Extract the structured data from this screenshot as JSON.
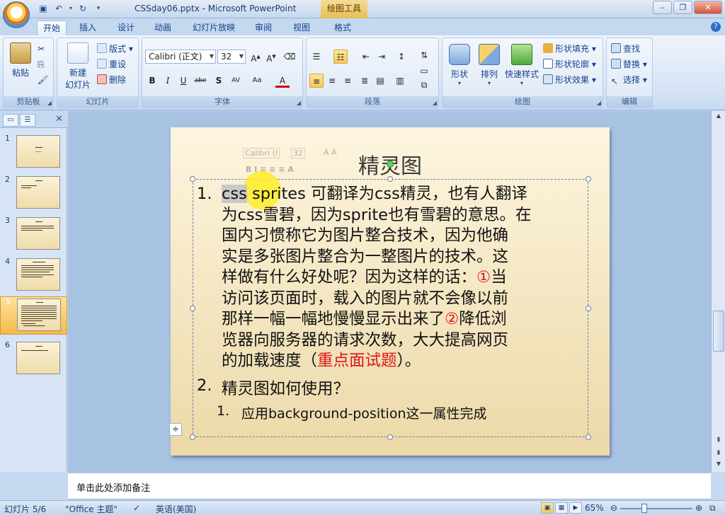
{
  "titlebar": {
    "title": "CSSday06.pptx - Microsoft PowerPoint",
    "context_tab": "绘图工具"
  },
  "tabs": [
    "开始",
    "插入",
    "设计",
    "动画",
    "幻灯片放映",
    "审阅",
    "视图",
    "格式"
  ],
  "ribbon": {
    "clipboard": {
      "label": "剪贴板",
      "paste": "粘贴"
    },
    "slides": {
      "label": "幻灯片",
      "new_slide_1": "新建",
      "new_slide_2": "幻灯片",
      "layout": "版式",
      "reset": "重设",
      "delete": "删除"
    },
    "font": {
      "label": "字体",
      "font_name": "Calibri (正文)",
      "font_size": "32"
    },
    "paragraph": {
      "label": "段落"
    },
    "drawing": {
      "label": "绘图",
      "shapes": "形状",
      "arrange": "排列",
      "quick_styles": "快速样式",
      "fill": "形状填充",
      "outline": "形状轮廓",
      "effects": "形状效果"
    },
    "editing": {
      "label": "编辑",
      "find": "查找",
      "replace": "替换",
      "select": "选择"
    }
  },
  "thumbnails": [
    {
      "num": "1"
    },
    {
      "num": "2"
    },
    {
      "num": "3"
    },
    {
      "num": "4"
    },
    {
      "num": "5",
      "selected": true
    },
    {
      "num": "6"
    }
  ],
  "slide": {
    "title": "精灵图",
    "mini_toolbar": {
      "font": "Calibri (I",
      "size": "32"
    },
    "item1_num": "1.",
    "item1_sel": "css",
    "item1_lines": [
      " sprites 可翻译为css精灵，也有人翻译",
      "为css雪碧，因为sprite也有雪碧的意思。在",
      "国内习惯称它为图片整合技术，因为他确",
      "实是多张图片整合为一整图片的技术。这",
      "样做有什么好处呢？因为这样的话：",
      "访问该页面时，载入的图片就不会像以前",
      "那样一幅一幅地慢慢显示出来了",
      "览器向服务器的请求次数，大大提高网页",
      "的加载速度（",
      "）。"
    ],
    "circled1": "①",
    "after_circled1": "当",
    "circled2": "②",
    "after_circled2": "降低浏",
    "highlight": "重点面试题",
    "item2_num": "2.",
    "item2": "精灵图如何使用？",
    "sub_num": "1.",
    "sub_item": "应用background-position这一属性完成"
  },
  "notes_placeholder": "单击此处添加备注",
  "statusbar": {
    "slide_count": "幻灯片 5/6",
    "theme": "\"Office 主题\"",
    "language": "英语(美国)",
    "zoom": "65%"
  }
}
